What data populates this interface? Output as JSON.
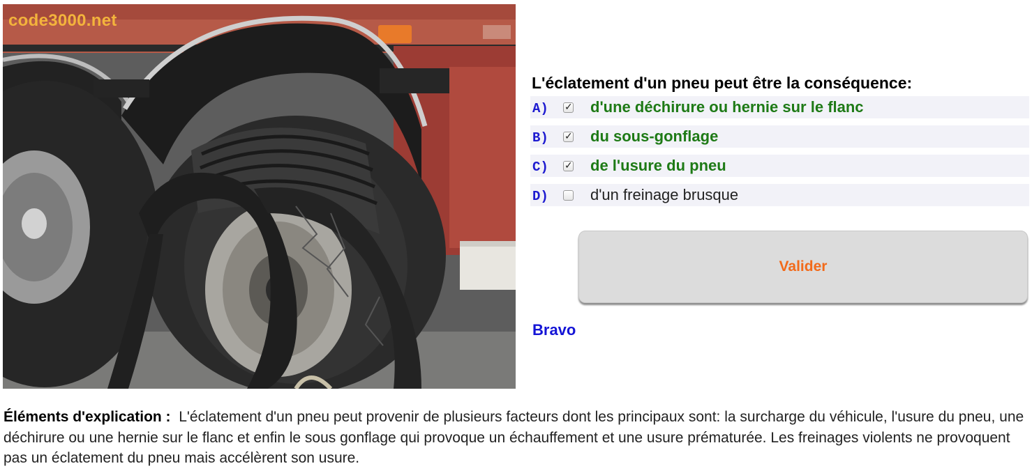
{
  "photo": {
    "watermark": "code3000.net",
    "alt_subject": "truck-burst-tire"
  },
  "question": {
    "title": "L'éclatement d'un pneu peut être la conséquence:",
    "answers": [
      {
        "letter": "A)",
        "text": "d'une déchirure ou hernie sur le flanc",
        "checked": true,
        "status": "correct"
      },
      {
        "letter": "B)",
        "text": "du sous-gonflage",
        "checked": true,
        "status": "correct"
      },
      {
        "letter": "C)",
        "text": "de l'usure du pneu",
        "checked": true,
        "status": "correct"
      },
      {
        "letter": "D)",
        "text": "d'un freinage brusque",
        "checked": false,
        "status": "plain"
      }
    ]
  },
  "actions": {
    "validate_label": "Valider"
  },
  "feedback": {
    "message": "Bravo"
  },
  "explanation": {
    "label": "Éléments d'explication :",
    "text": "L'éclatement d'un pneu peut provenir de plusieurs facteurs dont les principaux sont: la surcharge du véhicule, l'usure du pneu, une déchirure ou une hernie sur le flanc et enfin le sous gonflage qui provoque un échauffement et une usure prématurée. Les freinages violents ne provoquent pas un éclatement du pneu mais accélèrent son usure."
  },
  "colors": {
    "correct_text": "#1e7a16",
    "letter_blue": "#1d1ad0",
    "validate_text": "#f26a1a",
    "feedback_blue": "#1414d6",
    "watermark": "#f3b33c"
  }
}
